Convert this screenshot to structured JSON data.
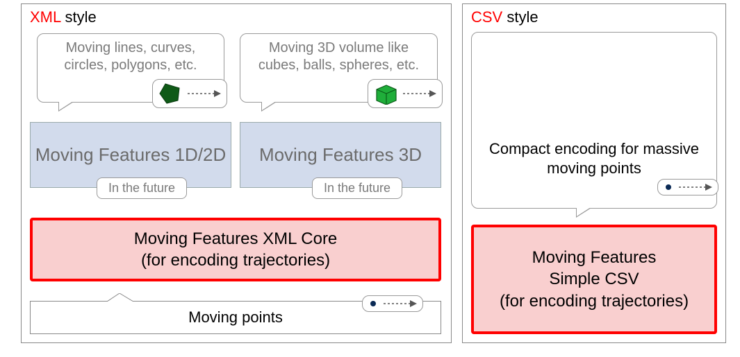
{
  "xml_panel": {
    "title_accent": "XML",
    "title_rest": " style",
    "speech_2d": "Moving lines, curves, circles, polygons, etc.",
    "speech_3d": "Moving 3D volume like cubes, balls, spheres, etc.",
    "feature_2d": "Moving Features 1D/2D",
    "feature_3d": "Moving Features 3D",
    "future_label": "In the future",
    "core": "Moving Features XML Core\n(for encoding trajectories)",
    "moving_points": "Moving points"
  },
  "csv_panel": {
    "title_accent": "CSV",
    "title_rest": " style",
    "speech": "Compact encoding for massive moving points",
    "core": "Moving Features\nSimple CSV\n(for encoding trajectories)"
  },
  "icons": {
    "pentagon": "green-pentagon-icon",
    "cube": "green-cube-icon",
    "point": "point-icon",
    "arrow": "dashed-arrow-icon"
  }
}
